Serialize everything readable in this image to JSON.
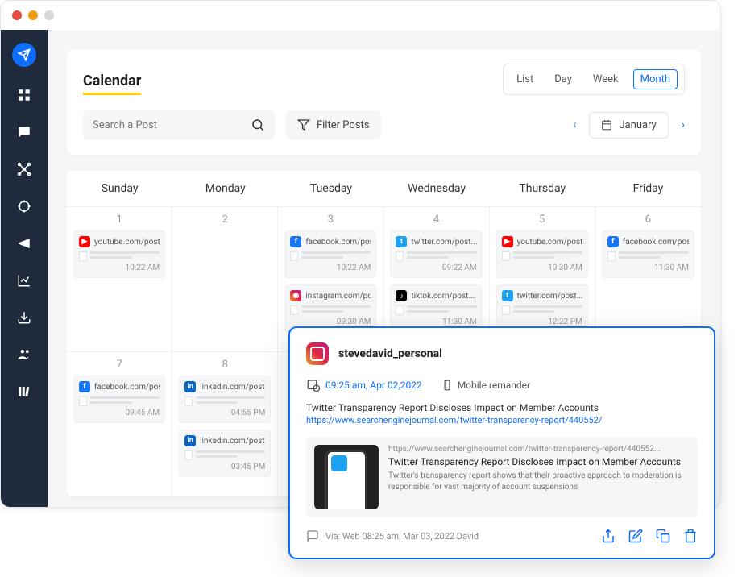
{
  "header": {
    "title": "Calendar",
    "views": [
      "List",
      "Day",
      "Week",
      "Month"
    ],
    "active_view": "Month",
    "search_placeholder": "Search a Post",
    "filter_label": "Filter Posts",
    "month_label": "January"
  },
  "days": [
    "Sunday",
    "Monday",
    "Tuesday",
    "Wednesday",
    "Thursday",
    "Friday"
  ],
  "cells": [
    {
      "num": "1",
      "posts": [
        {
          "net": "yt",
          "url": "youtube.com/post...",
          "time": "10:22 AM"
        }
      ]
    },
    {
      "num": "2",
      "posts": []
    },
    {
      "num": "3",
      "posts": [
        {
          "net": "fb",
          "url": "facebook.com/post...",
          "time": "10:22 AM"
        },
        {
          "net": "ig",
          "url": "instagram.com/post.",
          "time": "09:30 AM"
        }
      ]
    },
    {
      "num": "4",
      "posts": [
        {
          "net": "tw",
          "url": "twitter.com/post...",
          "time": "09:22 AM"
        },
        {
          "net": "tk",
          "url": "tiktok.com/post...",
          "time": "11:30 AM"
        }
      ]
    },
    {
      "num": "5",
      "posts": [
        {
          "net": "yt",
          "url": "youtube.com/post...",
          "time": "10:30 AM"
        },
        {
          "net": "tw",
          "url": "twitter.com/post...",
          "time": "12:22 PM"
        }
      ]
    },
    {
      "num": "6",
      "posts": [
        {
          "net": "fb",
          "url": "facebook.com/post...",
          "time": "11:30 AM"
        }
      ]
    },
    {
      "num": "7",
      "posts": [
        {
          "net": "fb",
          "url": "facebook.com/post...",
          "time": "09:45 AM"
        }
      ]
    },
    {
      "num": "8",
      "posts": [
        {
          "net": "li",
          "url": "linkedin.com/post...",
          "time": "04:55 PM"
        },
        {
          "net": "li",
          "url": "linkedin.com/post...",
          "time": "03:45 PM"
        }
      ]
    },
    {
      "num": "",
      "posts": []
    },
    {
      "num": "",
      "posts": []
    },
    {
      "num": "",
      "posts": []
    },
    {
      "num": "",
      "posts": []
    }
  ],
  "popup": {
    "username": "stevedavid_personal",
    "datetime": "09:25 am, Apr 02,2022",
    "reminder": "Mobile remander",
    "title": "Twitter Transparency Report Discloses Impact on Member Accounts",
    "link": "https://www.searchenginejournal.com/twitter-transparency-report/440552/",
    "preview_url": "https://www.searchenginejournal.com/twitter-transparency-report/440552...",
    "preview_title": "Twitter Transparency Report Discloses Impact on Member Accounts",
    "preview_desc": "Twitter's transparency report shows that their proactive approach to moderation is responsible for vast majority of account suspensions",
    "footer": "Via: Web  08:25 am, Mar 03, 2022  David"
  }
}
